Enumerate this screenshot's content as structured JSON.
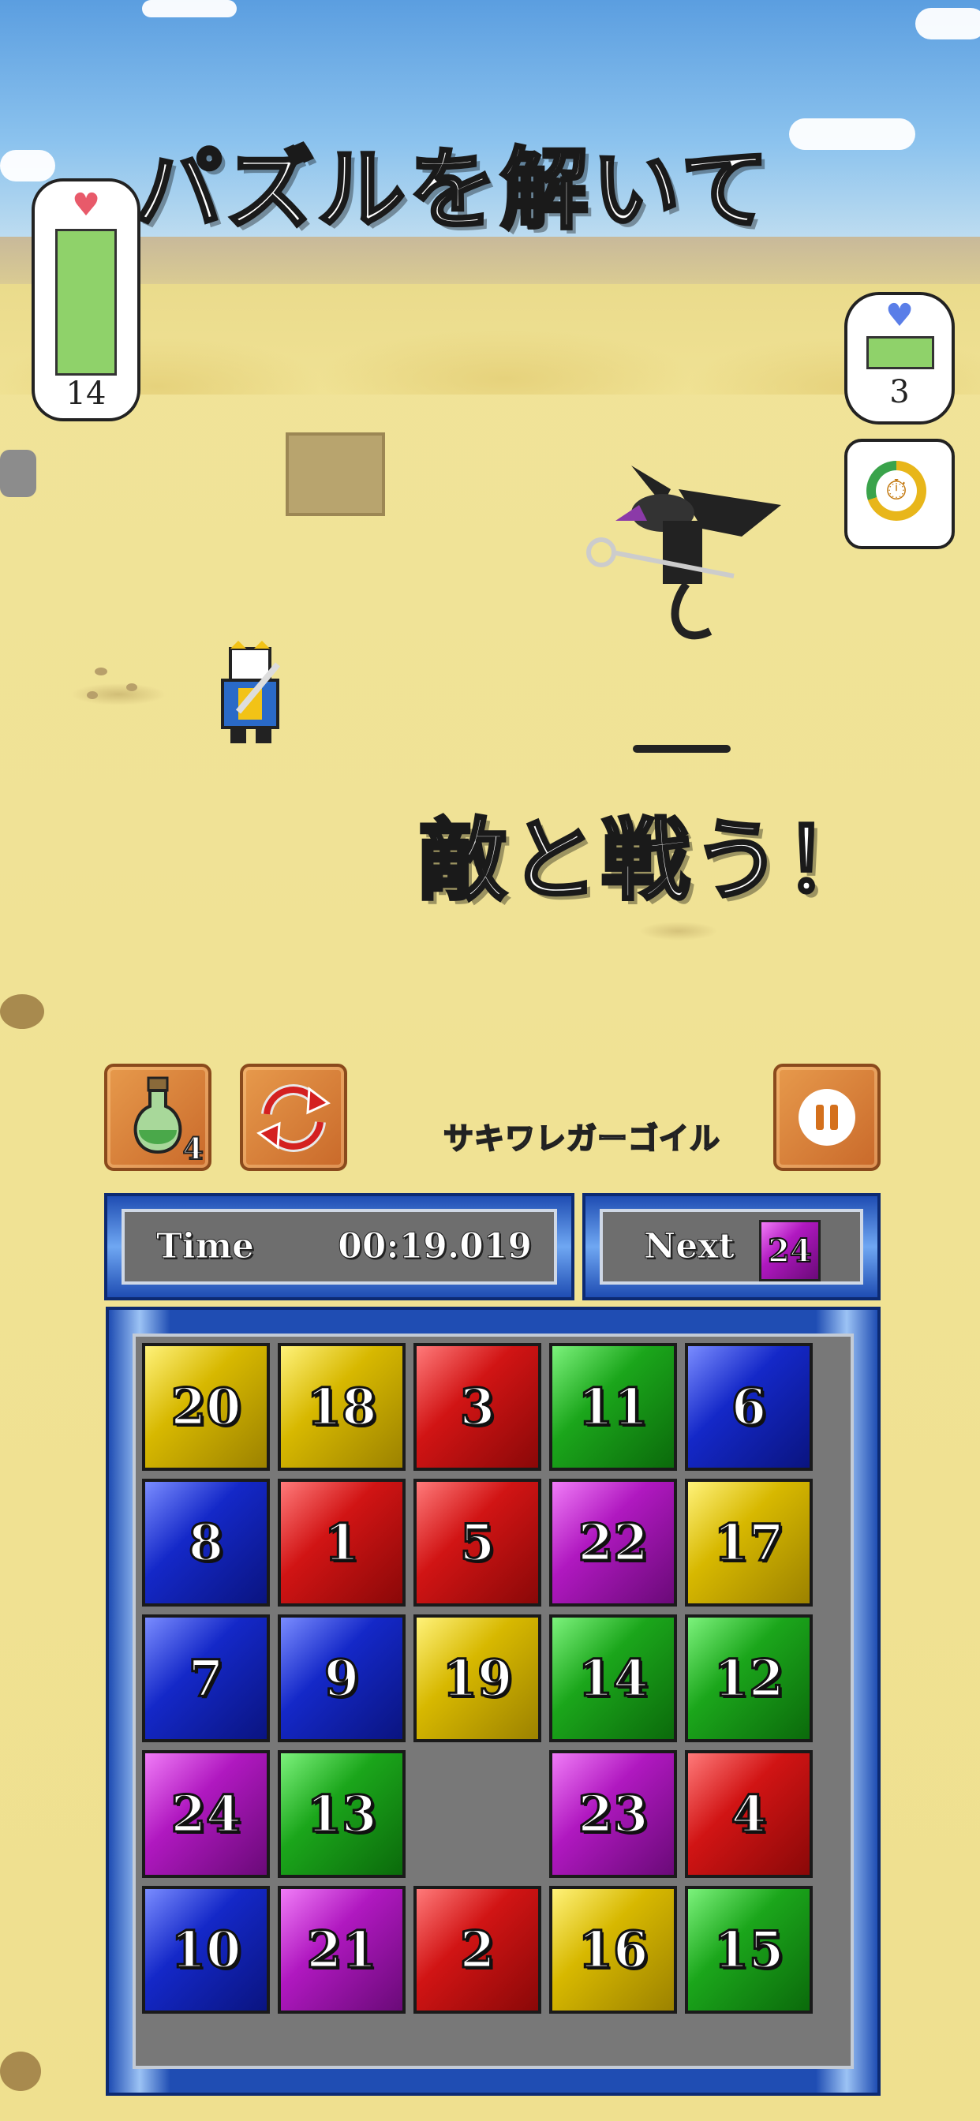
{
  "headlines": {
    "top": "パズルを解いて",
    "bottom": "敵と戦う！"
  },
  "player_hp": {
    "value": "14",
    "fraction": 1.0
  },
  "enemy_hp": {
    "value": "3",
    "fraction": 1.0
  },
  "enemy_name": "サキワレガーゴイル",
  "items": {
    "potion_count": "4"
  },
  "time": {
    "label": "Time",
    "value": "00:19.019"
  },
  "next": {
    "label": "Next",
    "value": "24"
  },
  "colors": {
    "yellow": "#d7b800",
    "red": "#d11414",
    "green": "#1ba61b",
    "blue": "#1428c8",
    "purple": "#b018c0"
  },
  "board": [
    [
      {
        "n": "20",
        "c": "yellow"
      },
      {
        "n": "18",
        "c": "yellow"
      },
      {
        "n": "3",
        "c": "red"
      },
      {
        "n": "11",
        "c": "green"
      },
      {
        "n": "6",
        "c": "blue"
      }
    ],
    [
      {
        "n": "8",
        "c": "blue"
      },
      {
        "n": "1",
        "c": "red"
      },
      {
        "n": "5",
        "c": "red"
      },
      {
        "n": "22",
        "c": "purple"
      },
      {
        "n": "17",
        "c": "yellow"
      }
    ],
    [
      {
        "n": "7",
        "c": "blue"
      },
      {
        "n": "9",
        "c": "blue"
      },
      {
        "n": "19",
        "c": "yellow"
      },
      {
        "n": "14",
        "c": "green"
      },
      {
        "n": "12",
        "c": "green"
      }
    ],
    [
      {
        "n": "24",
        "c": "purple"
      },
      {
        "n": "13",
        "c": "green"
      },
      null,
      {
        "n": "23",
        "c": "purple"
      },
      {
        "n": "4",
        "c": "red"
      }
    ],
    [
      {
        "n": "10",
        "c": "blue"
      },
      {
        "n": "21",
        "c": "purple"
      },
      {
        "n": "2",
        "c": "red"
      },
      {
        "n": "16",
        "c": "yellow"
      },
      {
        "n": "15",
        "c": "green"
      }
    ]
  ]
}
